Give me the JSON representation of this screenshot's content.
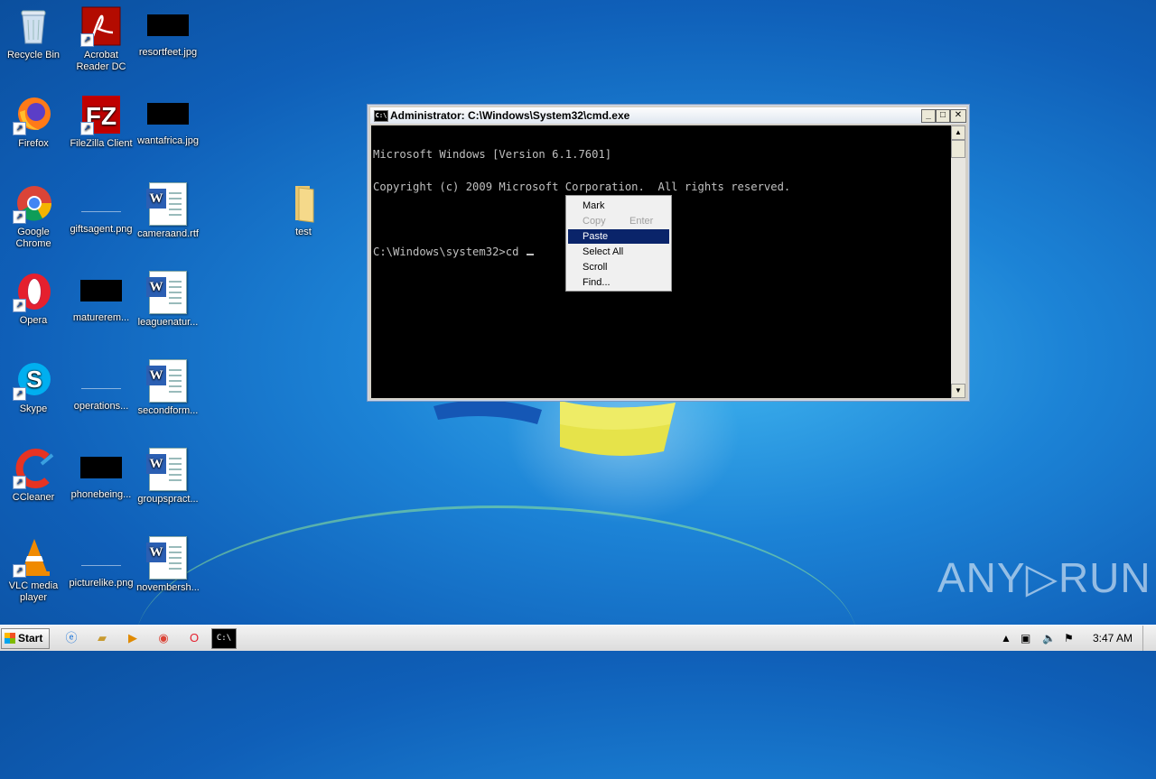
{
  "desktop": {
    "icons": [
      {
        "label": "Recycle Bin"
      },
      {
        "label": "Acrobat\nReader DC"
      },
      {
        "label": "resortfeet.jpg"
      },
      {
        "label": "Firefox"
      },
      {
        "label": "FileZilla Client"
      },
      {
        "label": "wantafrica.jpg"
      },
      {
        "label": "Google\nChrome"
      },
      {
        "label": "giftsagent.png"
      },
      {
        "label": "cameraand.rtf"
      },
      {
        "label": "test"
      },
      {
        "label": "Opera"
      },
      {
        "label": "maturerem..."
      },
      {
        "label": "leaguenatur..."
      },
      {
        "label": "Skype"
      },
      {
        "label": "operations..."
      },
      {
        "label": "secondform..."
      },
      {
        "label": "CCleaner"
      },
      {
        "label": "phonebeing..."
      },
      {
        "label": "groupspract..."
      },
      {
        "label": "VLC media\nplayer"
      },
      {
        "label": "picturelike.png"
      },
      {
        "label": "novembersh..."
      }
    ]
  },
  "cmd_window": {
    "title": "Administrator: C:\\Windows\\System32\\cmd.exe",
    "lines": [
      "Microsoft Windows [Version 6.1.7601]",
      "Copyright (c) 2009 Microsoft Corporation.  All rights reserved.",
      "",
      "C:\\Windows\\system32>cd "
    ]
  },
  "context_menu": {
    "items": [
      {
        "label": "Mark"
      },
      {
        "label": "Copy",
        "shortcut": "Enter",
        "disabled": true
      },
      {
        "label": "Paste",
        "highlighted": true
      },
      {
        "label": "Select All"
      },
      {
        "label": "Scroll"
      },
      {
        "label": "Find..."
      }
    ]
  },
  "watermark": {
    "text": "ANY▷RUN"
  },
  "taskbar": {
    "start_label": "Start",
    "clock": "3:47 AM"
  },
  "colors": {
    "desktop_blue": "#1c83d6",
    "menu_highlight": "#0a246a"
  }
}
